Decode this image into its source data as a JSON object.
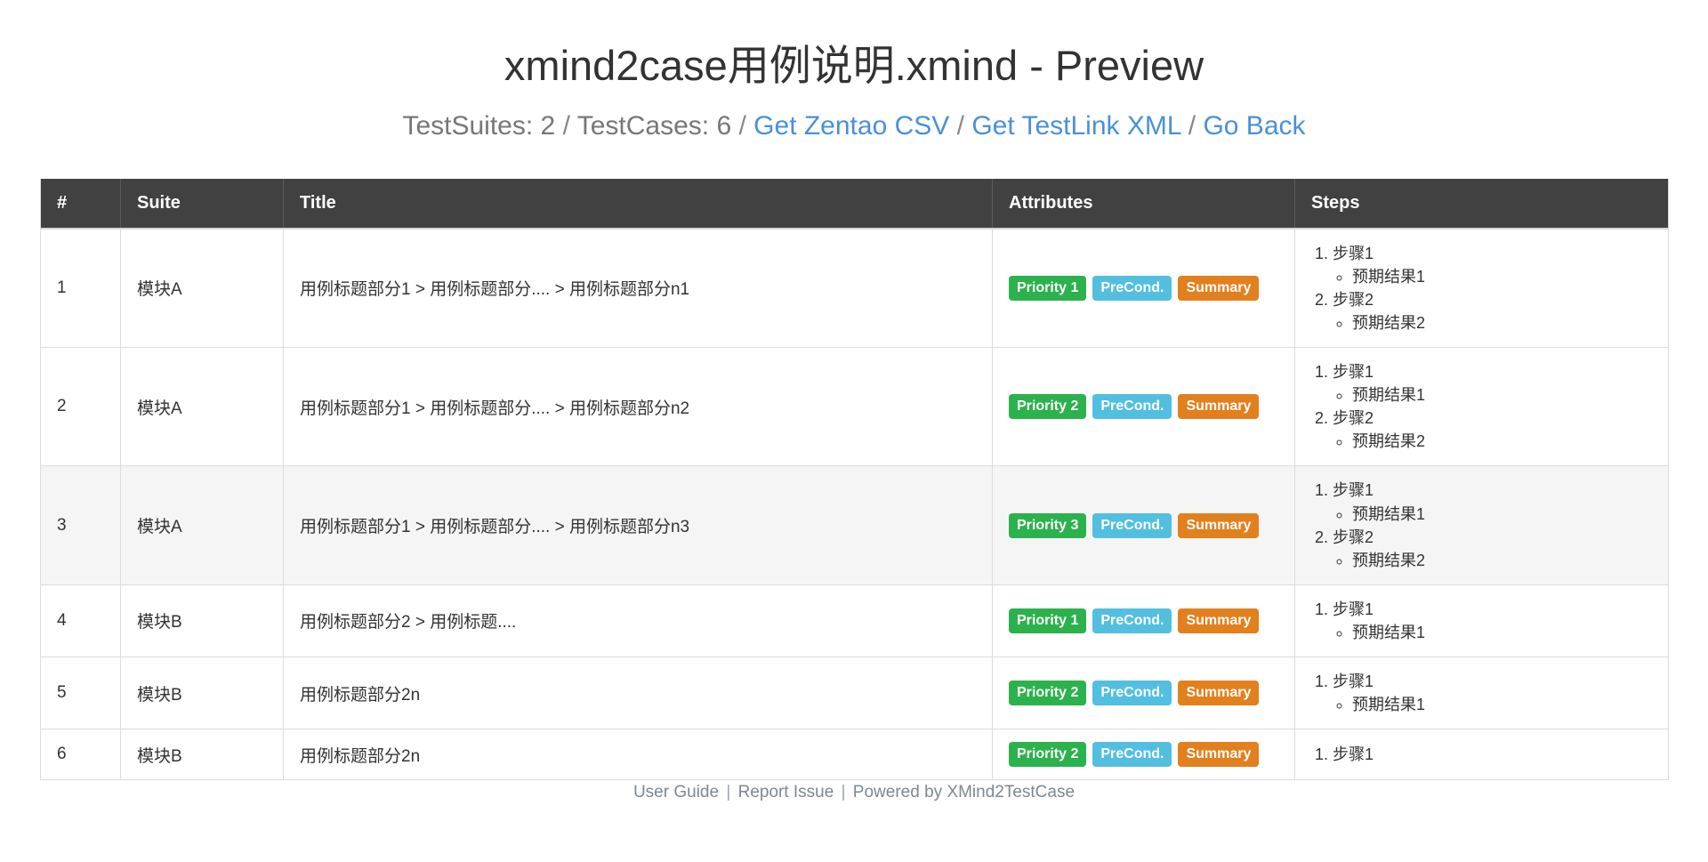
{
  "header": {
    "title": "xmind2case用例说明.xmind - Preview",
    "stats": {
      "suites_label": "TestSuites:",
      "suites_value": "2",
      "cases_label": "TestCases:",
      "cases_value": "6"
    },
    "separator": "/",
    "links": [
      {
        "label": "Get Zentao CSV"
      },
      {
        "label": "Get TestLink XML"
      },
      {
        "label": "Go Back"
      }
    ],
    "link_color": "#4a90d9"
  },
  "table": {
    "columns": [
      "#",
      "Suite",
      "Title",
      "Attributes",
      "Steps"
    ],
    "header_bg": "#414141",
    "highlight_row_bg": "#f5f5f5",
    "rows": [
      {
        "index": "1",
        "suite": "模块A",
        "title": "用例标题部分1 > 用例标题部分.... > 用例标题部分n1",
        "highlighted": false,
        "attributes": [
          {
            "name": "priority",
            "label": "Priority 1",
            "color": "#2bb24c"
          },
          {
            "name": "precondition",
            "label": "PreCond.",
            "color": "#52bfe0"
          },
          {
            "name": "summary",
            "label": "Summary",
            "color": "#e2801e"
          }
        ],
        "steps": [
          {
            "action": "步骤1",
            "expected": "预期结果1"
          },
          {
            "action": "步骤2",
            "expected": "预期结果2"
          }
        ]
      },
      {
        "index": "2",
        "suite": "模块A",
        "title": "用例标题部分1 > 用例标题部分.... > 用例标题部分n2",
        "highlighted": false,
        "attributes": [
          {
            "name": "priority",
            "label": "Priority 2",
            "color": "#2bb24c"
          },
          {
            "name": "precondition",
            "label": "PreCond.",
            "color": "#52bfe0"
          },
          {
            "name": "summary",
            "label": "Summary",
            "color": "#e2801e"
          }
        ],
        "steps": [
          {
            "action": "步骤1",
            "expected": "预期结果1"
          },
          {
            "action": "步骤2",
            "expected": "预期结果2"
          }
        ]
      },
      {
        "index": "3",
        "suite": "模块A",
        "title": "用例标题部分1 > 用例标题部分.... > 用例标题部分n3",
        "highlighted": true,
        "attributes": [
          {
            "name": "priority",
            "label": "Priority 3",
            "color": "#2bb24c"
          },
          {
            "name": "precondition",
            "label": "PreCond.",
            "color": "#52bfe0"
          },
          {
            "name": "summary",
            "label": "Summary",
            "color": "#e2801e"
          }
        ],
        "steps": [
          {
            "action": "步骤1",
            "expected": "预期结果1"
          },
          {
            "action": "步骤2",
            "expected": "预期结果2"
          }
        ]
      },
      {
        "index": "4",
        "suite": "模块B",
        "title": "用例标题部分2 > 用例标题....",
        "highlighted": false,
        "attributes": [
          {
            "name": "priority",
            "label": "Priority 1",
            "color": "#2bb24c"
          },
          {
            "name": "precondition",
            "label": "PreCond.",
            "color": "#52bfe0"
          },
          {
            "name": "summary",
            "label": "Summary",
            "color": "#e2801e"
          }
        ],
        "steps": [
          {
            "action": "步骤1",
            "expected": "预期结果1"
          }
        ]
      },
      {
        "index": "5",
        "suite": "模块B",
        "title": "用例标题部分2n",
        "highlighted": false,
        "attributes": [
          {
            "name": "priority",
            "label": "Priority 2",
            "color": "#2bb24c"
          },
          {
            "name": "precondition",
            "label": "PreCond.",
            "color": "#52bfe0"
          },
          {
            "name": "summary",
            "label": "Summary",
            "color": "#e2801e"
          }
        ],
        "steps": [
          {
            "action": "步骤1",
            "expected": "预期结果1"
          }
        ]
      },
      {
        "index": "6",
        "suite": "模块B",
        "title": "用例标题部分2n",
        "highlighted": false,
        "attributes": [
          {
            "name": "priority",
            "label": "Priority 2",
            "color": "#2bb24c"
          },
          {
            "name": "precondition",
            "label": "PreCond.",
            "color": "#52bfe0"
          },
          {
            "name": "summary",
            "label": "Summary",
            "color": "#e2801e"
          }
        ],
        "steps": [
          {
            "action": "步骤1",
            "expected": null
          }
        ]
      }
    ]
  },
  "footer": {
    "links": [
      {
        "label": "User Guide"
      },
      {
        "label": "Report Issue"
      }
    ],
    "separator": "|",
    "powered_by": "Powered by XMind2TestCase"
  }
}
